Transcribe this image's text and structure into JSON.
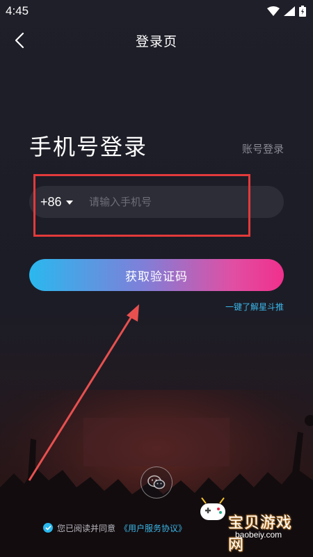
{
  "status_bar": {
    "time": "4:45",
    "icons": [
      "wifi-icon",
      "signal-icon",
      "battery-icon"
    ]
  },
  "header": {
    "title": "登录页",
    "back_icon": "chevron-left-icon"
  },
  "login": {
    "heading": "手机号登录",
    "account_login": "账号登录",
    "country_code": "+86",
    "phone_placeholder": "请输入手机号",
    "phone_value": "",
    "get_code_button": "获取验证码",
    "learn_more": "一键了解星斗推"
  },
  "social": {
    "wechat_icon": "wechat-icon"
  },
  "agreement": {
    "checked": true,
    "prefix": "您已阅读并同意",
    "link_text": "《用户服务协议》"
  },
  "watermark": {
    "text": "宝贝游戏网",
    "url": "baobeiy.com"
  },
  "colors": {
    "background": "#1c1c25",
    "input_bg": "#2d2d37",
    "gradient_start": "#2ab8ee",
    "gradient_end": "#f0308c",
    "link": "#3ab6e8",
    "annotation": "#e23a3a"
  }
}
